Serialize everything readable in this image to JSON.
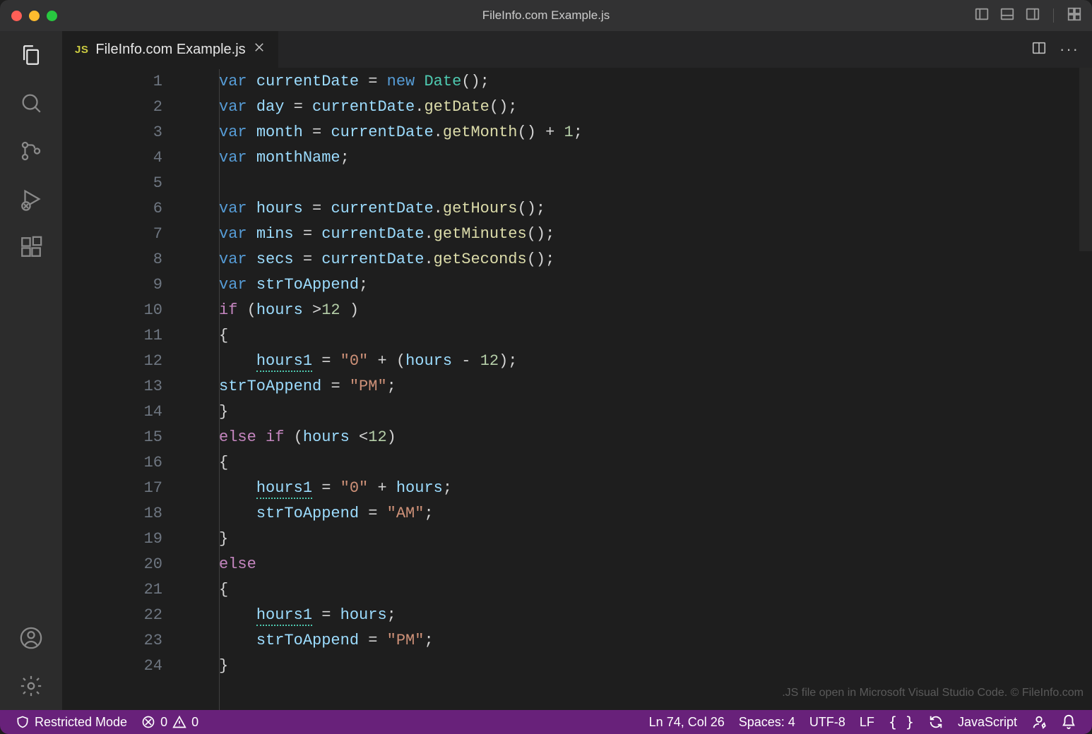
{
  "window": {
    "title": "FileInfo.com Example.js"
  },
  "tab": {
    "lang_badge": "JS",
    "filename": "FileInfo.com Example.js"
  },
  "editor": {
    "watermark": ".JS file open in Microsoft Visual Studio Code. © FileInfo.com",
    "lines": [
      {
        "n": 1,
        "tokens": [
          [
            "kw",
            "var"
          ],
          [
            "sp",
            " "
          ],
          [
            "ident",
            "currentDate"
          ],
          [
            "sp",
            " "
          ],
          [
            "op",
            "="
          ],
          [
            "sp",
            " "
          ],
          [
            "newkw",
            "new"
          ],
          [
            "sp",
            " "
          ],
          [
            "cls",
            "Date"
          ],
          [
            "punc",
            "();"
          ]
        ]
      },
      {
        "n": 2,
        "tokens": [
          [
            "kw",
            "var"
          ],
          [
            "sp",
            " "
          ],
          [
            "ident",
            "day"
          ],
          [
            "sp",
            " "
          ],
          [
            "op",
            "="
          ],
          [
            "sp",
            " "
          ],
          [
            "ident",
            "currentDate"
          ],
          [
            "punc",
            "."
          ],
          [
            "fn",
            "getDate"
          ],
          [
            "punc",
            "();"
          ]
        ]
      },
      {
        "n": 3,
        "tokens": [
          [
            "kw",
            "var"
          ],
          [
            "sp",
            " "
          ],
          [
            "ident",
            "month"
          ],
          [
            "sp",
            " "
          ],
          [
            "op",
            "="
          ],
          [
            "sp",
            " "
          ],
          [
            "ident",
            "currentDate"
          ],
          [
            "punc",
            "."
          ],
          [
            "fn",
            "getMonth"
          ],
          [
            "punc",
            "()"
          ],
          [
            "sp",
            " "
          ],
          [
            "op",
            "+"
          ],
          [
            "sp",
            " "
          ],
          [
            "num",
            "1"
          ],
          [
            "punc",
            ";"
          ]
        ]
      },
      {
        "n": 4,
        "tokens": [
          [
            "kw",
            "var"
          ],
          [
            "sp",
            " "
          ],
          [
            "ident",
            "monthName"
          ],
          [
            "punc",
            ";"
          ]
        ]
      },
      {
        "n": 5,
        "tokens": []
      },
      {
        "n": 6,
        "tokens": [
          [
            "kw",
            "var"
          ],
          [
            "sp",
            " "
          ],
          [
            "ident",
            "hours"
          ],
          [
            "sp",
            " "
          ],
          [
            "op",
            "="
          ],
          [
            "sp",
            " "
          ],
          [
            "ident",
            "currentDate"
          ],
          [
            "punc",
            "."
          ],
          [
            "fn",
            "getHours"
          ],
          [
            "punc",
            "();"
          ]
        ]
      },
      {
        "n": 7,
        "tokens": [
          [
            "kw",
            "var"
          ],
          [
            "sp",
            " "
          ],
          [
            "ident",
            "mins"
          ],
          [
            "sp",
            " "
          ],
          [
            "op",
            "="
          ],
          [
            "sp",
            " "
          ],
          [
            "ident",
            "currentDate"
          ],
          [
            "punc",
            "."
          ],
          [
            "fn",
            "getMinutes"
          ],
          [
            "punc",
            "();"
          ]
        ]
      },
      {
        "n": 8,
        "tokens": [
          [
            "kw",
            "var"
          ],
          [
            "sp",
            " "
          ],
          [
            "ident",
            "secs"
          ],
          [
            "sp",
            " "
          ],
          [
            "op",
            "="
          ],
          [
            "sp",
            " "
          ],
          [
            "ident",
            "currentDate"
          ],
          [
            "punc",
            "."
          ],
          [
            "fn",
            "getSeconds"
          ],
          [
            "punc",
            "();"
          ]
        ]
      },
      {
        "n": 9,
        "tokens": [
          [
            "kw",
            "var"
          ],
          [
            "sp",
            " "
          ],
          [
            "ident",
            "strToAppend"
          ],
          [
            "punc",
            ";"
          ]
        ]
      },
      {
        "n": 10,
        "tokens": [
          [
            "kw2",
            "if"
          ],
          [
            "sp",
            " "
          ],
          [
            "punc",
            "("
          ],
          [
            "ident",
            "hours"
          ],
          [
            "sp",
            " "
          ],
          [
            "op",
            ">"
          ],
          [
            "num",
            "12"
          ],
          [
            "sp",
            " "
          ],
          [
            "punc",
            ")"
          ]
        ]
      },
      {
        "n": 11,
        "tokens": [
          [
            "punc",
            "{"
          ]
        ]
      },
      {
        "n": 12,
        "tokens": [
          [
            "sp",
            "    "
          ],
          [
            "identw",
            "hours1"
          ],
          [
            "sp",
            " "
          ],
          [
            "op",
            "="
          ],
          [
            "sp",
            " "
          ],
          [
            "str",
            "\"0\""
          ],
          [
            "sp",
            " "
          ],
          [
            "op",
            "+"
          ],
          [
            "sp",
            " "
          ],
          [
            "punc",
            "("
          ],
          [
            "ident",
            "hours"
          ],
          [
            "sp",
            " "
          ],
          [
            "op",
            "-"
          ],
          [
            "sp",
            " "
          ],
          [
            "num",
            "12"
          ],
          [
            "punc",
            ");"
          ]
        ]
      },
      {
        "n": 13,
        "tokens": [
          [
            "ident",
            "strToAppend"
          ],
          [
            "sp",
            " "
          ],
          [
            "op",
            "="
          ],
          [
            "sp",
            " "
          ],
          [
            "str",
            "\"PM\""
          ],
          [
            "punc",
            ";"
          ]
        ]
      },
      {
        "n": 14,
        "tokens": [
          [
            "punc",
            "}"
          ]
        ]
      },
      {
        "n": 15,
        "tokens": [
          [
            "kw2",
            "else"
          ],
          [
            "sp",
            " "
          ],
          [
            "kw2",
            "if"
          ],
          [
            "sp",
            " "
          ],
          [
            "punc",
            "("
          ],
          [
            "ident",
            "hours"
          ],
          [
            "sp",
            " "
          ],
          [
            "op",
            "<"
          ],
          [
            "num",
            "12"
          ],
          [
            "punc",
            ")"
          ]
        ]
      },
      {
        "n": 16,
        "tokens": [
          [
            "punc",
            "{"
          ]
        ]
      },
      {
        "n": 17,
        "tokens": [
          [
            "sp",
            "    "
          ],
          [
            "identw",
            "hours1"
          ],
          [
            "sp",
            " "
          ],
          [
            "op",
            "="
          ],
          [
            "sp",
            " "
          ],
          [
            "str",
            "\"0\""
          ],
          [
            "sp",
            " "
          ],
          [
            "op",
            "+"
          ],
          [
            "sp",
            " "
          ],
          [
            "ident",
            "hours"
          ],
          [
            "punc",
            ";"
          ]
        ]
      },
      {
        "n": 18,
        "tokens": [
          [
            "sp",
            "    "
          ],
          [
            "ident",
            "strToAppend"
          ],
          [
            "sp",
            " "
          ],
          [
            "op",
            "="
          ],
          [
            "sp",
            " "
          ],
          [
            "str",
            "\"AM\""
          ],
          [
            "punc",
            ";"
          ]
        ]
      },
      {
        "n": 19,
        "tokens": [
          [
            "punc",
            "}"
          ]
        ]
      },
      {
        "n": 20,
        "tokens": [
          [
            "kw2",
            "else"
          ]
        ]
      },
      {
        "n": 21,
        "tokens": [
          [
            "punc",
            "{"
          ]
        ]
      },
      {
        "n": 22,
        "tokens": [
          [
            "sp",
            "    "
          ],
          [
            "identw",
            "hours1"
          ],
          [
            "sp",
            " "
          ],
          [
            "op",
            "="
          ],
          [
            "sp",
            " "
          ],
          [
            "ident",
            "hours"
          ],
          [
            "punc",
            ";"
          ]
        ]
      },
      {
        "n": 23,
        "tokens": [
          [
            "sp",
            "    "
          ],
          [
            "ident",
            "strToAppend"
          ],
          [
            "sp",
            " "
          ],
          [
            "op",
            "="
          ],
          [
            "sp",
            " "
          ],
          [
            "str",
            "\"PM\""
          ],
          [
            "punc",
            ";"
          ]
        ]
      },
      {
        "n": 24,
        "tokens": [
          [
            "punc",
            "}"
          ]
        ]
      }
    ]
  },
  "status": {
    "restricted": "Restricted Mode",
    "errors": "0",
    "warnings": "0",
    "position": "Ln 74, Col 26",
    "spaces": "Spaces: 4",
    "encoding": "UTF-8",
    "eol": "LF",
    "language": "JavaScript"
  }
}
